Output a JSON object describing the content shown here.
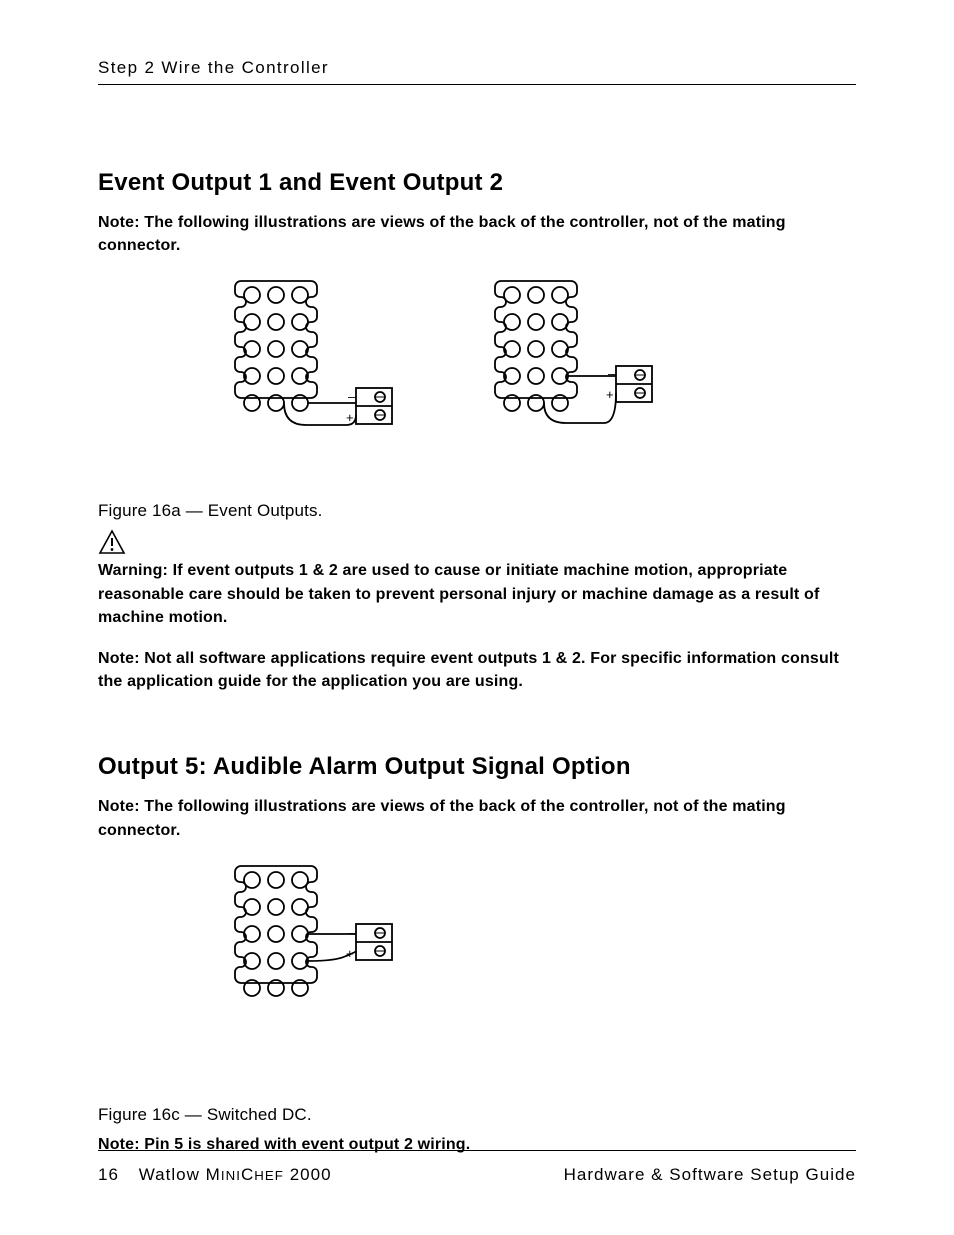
{
  "header": {
    "running_head": "Step 2 Wire the Controller"
  },
  "section1": {
    "title": "Event Output 1 and Event Output 2",
    "note1_label": "Note:",
    "note1_text": "The following illustrations are views of the back of the controller, not of the mating connector.",
    "caption": "Figure 16a — Event Outputs.",
    "warning_label": "Warning:",
    "warning_text": "If event outputs 1 & 2 are used to cause or initiate machine motion, appropriate reasonable care should be taken to prevent personal injury or machine damage as a result of machine motion.",
    "note2_label": "Note:",
    "note2_text": "Not all software applications require event outputs 1 & 2. For specific information consult the application guide for the application you are using."
  },
  "section2": {
    "title": "Output 5: Audible Alarm Output Signal Option",
    "note1_label": "Note:",
    "note1_text": "The following illustrations are views of the back of the controller, not of the mating connector.",
    "caption": "Figure 16c — Switched DC.",
    "note2_label": "Note:",
    "note2_text": "Pin 5 is shared with event output 2 wiring."
  },
  "footer": {
    "page_number": "16",
    "product_prefix": "Watlow M",
    "product_mid_sc": "INI",
    "product_c": "C",
    "product_hef_sc": "HEF",
    "product_suffix": " 2000",
    "doc_title": "Hardware & Software Setup Guide"
  },
  "diagram_labels": {
    "minus": "–",
    "plus": "+"
  }
}
